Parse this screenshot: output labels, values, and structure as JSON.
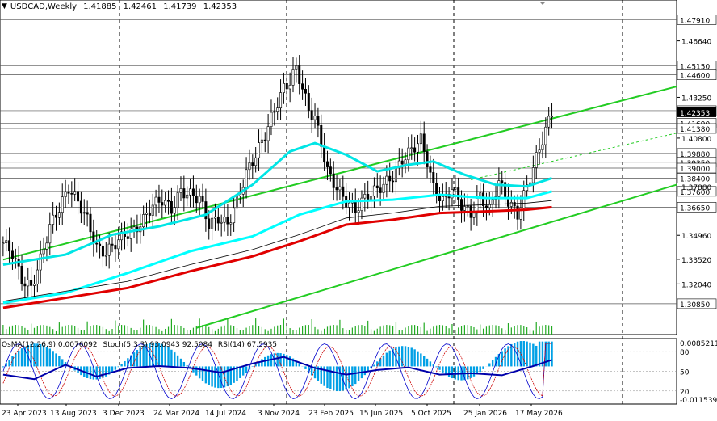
{
  "header": {
    "symbol": "USDCAD,Weekly",
    "open": "1.41885",
    "high": "1.42461",
    "low": "1.41739",
    "close": "1.42353"
  },
  "indicator_header": {
    "osma": "OsMA(12,26,9) 0.0076092",
    "stoch": "Stoch(5,3,3) 93.0943 92.5084",
    "rsi": "RSI(14) 67.5935"
  },
  "colors": {
    "candle": "#000000",
    "ema_fast": "#00e5e5",
    "ema_mid": "#00ffff",
    "ema_slow": "#e00000",
    "ema_thin": "#000000",
    "trend": "#22cc22",
    "histogram": "#00a0e6",
    "stoch_main": "#0000cc",
    "stoch_signal": "#cc0000",
    "rsi": "#0000aa",
    "volume": "#22aa22",
    "axis_text": "#000000"
  },
  "chart_data": {
    "type": "candlestick",
    "ylim": [
      1.29,
      1.49
    ],
    "price_ticks": [
      "1.46640",
      "1.43250",
      "1.40800",
      "1.37880",
      "1.34960",
      "1.33520",
      "1.32040"
    ],
    "level_labels": [
      "1.47910",
      "1.45150",
      "1.44600",
      "1.42450",
      "1.41690",
      "1.41380",
      "1.39880",
      "1.39350",
      "1.39000",
      "1.38400",
      "1.37600",
      "1.36650",
      "1.30850"
    ],
    "last_price": "1.42353",
    "x_labels": [
      "23 Apr 2023",
      "13 Aug 2023",
      "3 Dec 2023",
      "24 Mar 2024",
      "14 Jul 2024",
      "3 Nov 2024",
      "23 Feb 2025",
      "15 Jun 2025",
      "5 Oct 2025",
      "25 Jan 2026",
      "17 May 2026"
    ],
    "indicator_ticks": [
      "0.0085211",
      "80",
      "50",
      "20",
      "-0.011539"
    ],
    "indicator_ylim": [
      -0.0115,
      0.0085
    ],
    "weekly_close_path": [
      {
        "w": 0,
        "c": 1.345
      },
      {
        "w": 3,
        "c": 1.339
      },
      {
        "w": 6,
        "c": 1.323
      },
      {
        "w": 9,
        "c": 1.318
      },
      {
        "w": 12,
        "c": 1.335
      },
      {
        "w": 15,
        "c": 1.355
      },
      {
        "w": 18,
        "c": 1.366
      },
      {
        "w": 21,
        "c": 1.378
      },
      {
        "w": 24,
        "c": 1.37
      },
      {
        "w": 27,
        "c": 1.359
      },
      {
        "w": 30,
        "c": 1.342
      },
      {
        "w": 33,
        "c": 1.339
      },
      {
        "w": 36,
        "c": 1.345
      },
      {
        "w": 39,
        "c": 1.35
      },
      {
        "w": 42,
        "c": 1.352
      },
      {
        "w": 45,
        "c": 1.359
      },
      {
        "w": 48,
        "c": 1.368
      },
      {
        "w": 51,
        "c": 1.371
      },
      {
        "w": 54,
        "c": 1.365
      },
      {
        "w": 57,
        "c": 1.376
      },
      {
        "w": 60,
        "c": 1.374
      },
      {
        "w": 63,
        "c": 1.372
      },
      {
        "w": 66,
        "c": 1.356
      },
      {
        "w": 69,
        "c": 1.36
      },
      {
        "w": 72,
        "c": 1.356
      },
      {
        "w": 75,
        "c": 1.37
      },
      {
        "w": 78,
        "c": 1.387
      },
      {
        "w": 81,
        "c": 1.398
      },
      {
        "w": 84,
        "c": 1.41
      },
      {
        "w": 87,
        "c": 1.425
      },
      {
        "w": 90,
        "c": 1.438
      },
      {
        "w": 92,
        "c": 1.442
      },
      {
        "w": 94,
        "c": 1.45
      },
      {
        "w": 96,
        "c": 1.438
      },
      {
        "w": 98,
        "c": 1.425
      },
      {
        "w": 100,
        "c": 1.42
      },
      {
        "w": 102,
        "c": 1.405
      },
      {
        "w": 104,
        "c": 1.388
      },
      {
        "w": 107,
        "c": 1.378
      },
      {
        "w": 110,
        "c": 1.37
      },
      {
        "w": 113,
        "c": 1.365
      },
      {
        "w": 116,
        "c": 1.372
      },
      {
        "w": 119,
        "c": 1.376
      },
      {
        "w": 122,
        "c": 1.38
      },
      {
        "w": 125,
        "c": 1.385
      },
      {
        "w": 128,
        "c": 1.395
      },
      {
        "w": 131,
        "c": 1.401
      },
      {
        "w": 134,
        "c": 1.407
      },
      {
        "w": 136,
        "c": 1.394
      },
      {
        "w": 138,
        "c": 1.378
      },
      {
        "w": 141,
        "c": 1.37
      },
      {
        "w": 144,
        "c": 1.378
      },
      {
        "w": 147,
        "c": 1.368
      },
      {
        "w": 150,
        "c": 1.362
      },
      {
        "w": 153,
        "c": 1.373
      },
      {
        "w": 156,
        "c": 1.365
      },
      {
        "w": 159,
        "c": 1.382
      },
      {
        "w": 162,
        "c": 1.37
      },
      {
        "w": 165,
        "c": 1.362
      },
      {
        "w": 168,
        "c": 1.379
      },
      {
        "w": 171,
        "c": 1.396
      },
      {
        "w": 174,
        "c": 1.413
      },
      {
        "w": 176,
        "c": 1.4235
      }
    ],
    "moving_averages": [
      {
        "name": "",
        "color": "#00e5e5",
        "points": [
          {
            "w": 0,
            "v": 1.332
          },
          {
            "w": 20,
            "v": 1.338
          },
          {
            "w": 35,
            "v": 1.35
          },
          {
            "w": 50,
            "v": 1.355
          },
          {
            "w": 65,
            "v": 1.362
          },
          {
            "w": 80,
            "v": 1.38
          },
          {
            "w": 92,
            "v": 1.4
          },
          {
            "w": 100,
            "v": 1.405
          },
          {
            "w": 110,
            "v": 1.398
          },
          {
            "w": 120,
            "v": 1.388
          },
          {
            "w": 130,
            "v": 1.392
          },
          {
            "w": 138,
            "v": 1.394
          },
          {
            "w": 148,
            "v": 1.386
          },
          {
            "w": 158,
            "v": 1.38
          },
          {
            "w": 168,
            "v": 1.379
          },
          {
            "w": 176,
            "v": 1.384
          }
        ]
      },
      {
        "name": "",
        "color": "#00ffff",
        "points": [
          {
            "w": 0,
            "v": 1.309
          },
          {
            "w": 20,
            "v": 1.315
          },
          {
            "w": 40,
            "v": 1.327
          },
          {
            "w": 60,
            "v": 1.34
          },
          {
            "w": 80,
            "v": 1.349
          },
          {
            "w": 95,
            "v": 1.362
          },
          {
            "w": 110,
            "v": 1.37
          },
          {
            "w": 125,
            "v": 1.371
          },
          {
            "w": 140,
            "v": 1.374
          },
          {
            "w": 155,
            "v": 1.372
          },
          {
            "w": 168,
            "v": 1.372
          },
          {
            "w": 176,
            "v": 1.376
          }
        ]
      },
      {
        "name": "",
        "color": "#e00000",
        "points": [
          {
            "w": 0,
            "v": 1.306
          },
          {
            "w": 20,
            "v": 1.312
          },
          {
            "w": 40,
            "v": 1.318
          },
          {
            "w": 60,
            "v": 1.328
          },
          {
            "w": 80,
            "v": 1.337
          },
          {
            "w": 95,
            "v": 1.346
          },
          {
            "w": 110,
            "v": 1.356
          },
          {
            "w": 125,
            "v": 1.359
          },
          {
            "w": 140,
            "v": 1.363
          },
          {
            "w": 155,
            "v": 1.364
          },
          {
            "w": 168,
            "v": 1.365
          },
          {
            "w": 176,
            "v": 1.3665
          }
        ]
      }
    ],
    "trend_lines": [
      {
        "from": {
          "w": 0,
          "v": 1.335
        },
        "to": {
          "w": 216,
          "v": 1.439
        }
      },
      {
        "from": {
          "w": 62,
          "v": 1.294
        },
        "to": {
          "w": 216,
          "v": 1.38
        }
      }
    ],
    "rsi_points": [
      {
        "w": 0,
        "v": 45
      },
      {
        "w": 10,
        "v": 38
      },
      {
        "w": 20,
        "v": 60
      },
      {
        "w": 30,
        "v": 42
      },
      {
        "w": 40,
        "v": 55
      },
      {
        "w": 50,
        "v": 58
      },
      {
        "w": 60,
        "v": 55
      },
      {
        "w": 70,
        "v": 48
      },
      {
        "w": 80,
        "v": 62
      },
      {
        "w": 90,
        "v": 72
      },
      {
        "w": 100,
        "v": 55
      },
      {
        "w": 110,
        "v": 45
      },
      {
        "w": 120,
        "v": 52
      },
      {
        "w": 130,
        "v": 56
      },
      {
        "w": 140,
        "v": 45
      },
      {
        "w": 150,
        "v": 47
      },
      {
        "w": 160,
        "v": 44
      },
      {
        "w": 170,
        "v": 58
      },
      {
        "w": 176,
        "v": 67.59
      }
    ]
  }
}
